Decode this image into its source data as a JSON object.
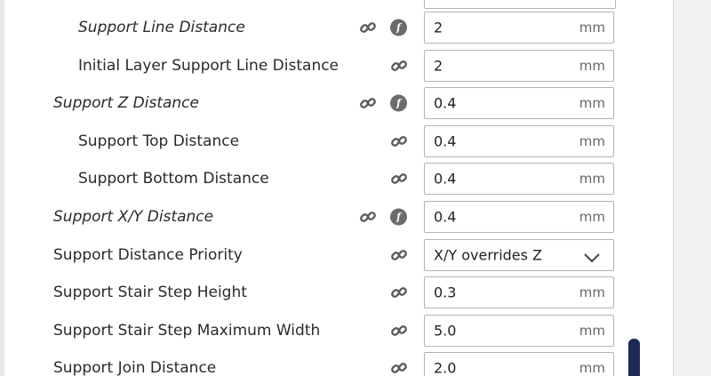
{
  "settings": [
    {
      "label": "Support Line Distance",
      "italic": true,
      "indent": true,
      "linked": true,
      "formula": true,
      "value": "2",
      "unit": "mm"
    },
    {
      "label": "Initial Layer Support Line Distance",
      "italic": false,
      "indent": true,
      "linked": true,
      "formula": false,
      "value": "2",
      "unit": "mm"
    },
    {
      "label": "Support Z Distance",
      "italic": true,
      "indent": false,
      "linked": true,
      "formula": true,
      "value": "0.4",
      "unit": "mm"
    },
    {
      "label": "Support Top Distance",
      "italic": false,
      "indent": true,
      "linked": true,
      "formula": false,
      "value": "0.4",
      "unit": "mm"
    },
    {
      "label": "Support Bottom Distance",
      "italic": false,
      "indent": true,
      "linked": true,
      "formula": false,
      "value": "0.4",
      "unit": "mm"
    },
    {
      "label": "Support X/Y Distance",
      "italic": true,
      "indent": false,
      "linked": true,
      "formula": true,
      "value": "0.4",
      "unit": "mm"
    },
    {
      "label": "Support Distance Priority",
      "italic": false,
      "indent": false,
      "linked": true,
      "formula": false,
      "value": "X/Y overrides Z",
      "unit": "",
      "dropdown": true
    },
    {
      "label": "Support Stair Step Height",
      "italic": false,
      "indent": false,
      "linked": true,
      "formula": false,
      "value": "0.3",
      "unit": "mm"
    },
    {
      "label": "Support Stair Step Maximum Width",
      "italic": false,
      "indent": false,
      "linked": true,
      "formula": false,
      "value": "5.0",
      "unit": "mm"
    },
    {
      "label": "Support Join Distance",
      "italic": false,
      "indent": false,
      "linked": true,
      "formula": false,
      "value": "2.0",
      "unit": "mm"
    }
  ],
  "icons": {
    "link": "link-icon",
    "formula": "function-icon",
    "dropdown": "chevron-down-icon"
  },
  "colors": {
    "scroll_thumb": "#1d2a55",
    "icon_gray": "#6b6b6b",
    "field_border": "#b4b4b4"
  }
}
